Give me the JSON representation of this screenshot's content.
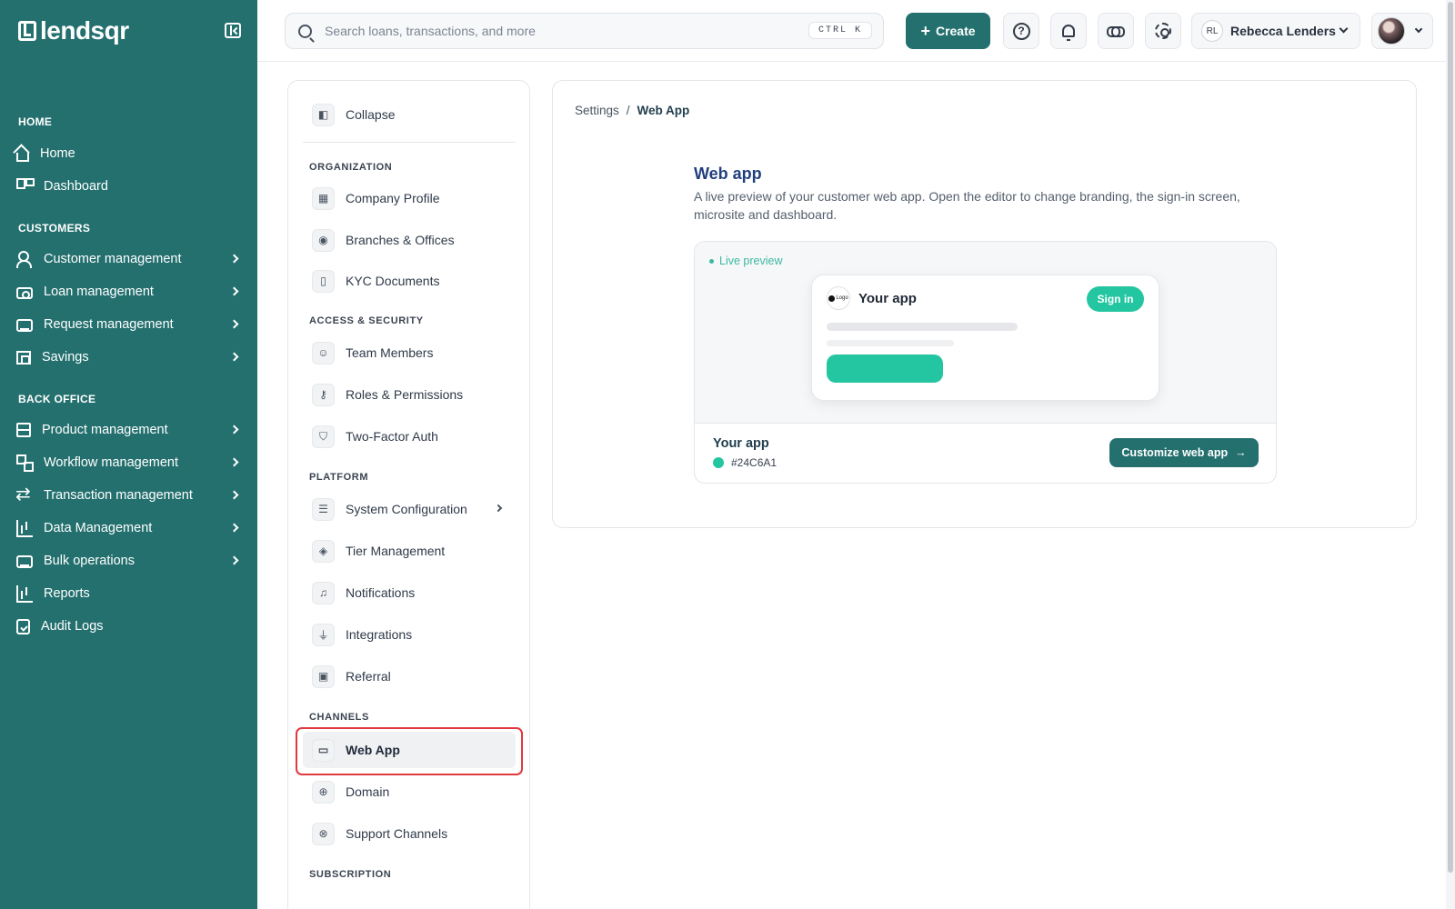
{
  "brand": {
    "name": "lendsqr"
  },
  "sidebar": {
    "sections": {
      "home": "HOME",
      "customers": "CUSTOMERS",
      "back_office": "BACK OFFICE"
    },
    "items": [
      {
        "label": "Home",
        "icon": "home-icon"
      },
      {
        "label": "Dashboard",
        "icon": "dashboard-icon"
      },
      {
        "label": "Customer management",
        "icon": "users-icon"
      },
      {
        "label": "Loan management",
        "icon": "loan-icon"
      },
      {
        "label": "Request management",
        "icon": "inbox-icon"
      },
      {
        "label": "Savings",
        "icon": "bank-icon"
      },
      {
        "label": "Product management",
        "icon": "box-icon"
      },
      {
        "label": "Workflow management",
        "icon": "workflow-icon"
      },
      {
        "label": "Transaction management",
        "icon": "swap-icon"
      },
      {
        "label": "Data Management",
        "icon": "bar-chart-icon"
      },
      {
        "label": "Bulk operations",
        "icon": "inbox-icon"
      },
      {
        "label": "Reports",
        "icon": "bar-chart-icon"
      },
      {
        "label": "Audit Logs",
        "icon": "clipboard-icon"
      }
    ]
  },
  "topbar": {
    "search_placeholder": "Search loans, transactions, and more",
    "shortcut": "CTRL K",
    "create_label": "Create",
    "user_initials": "RL",
    "user_name": "Rebecca Lenders"
  },
  "settings_nav": {
    "collapse": "Collapse",
    "sections": {
      "organization": "ORGANIZATION",
      "access": "ACCESS & SECURITY",
      "platform": "PLATFORM",
      "channels": "CHANNELS",
      "subscription": "SUBSCRIPTION"
    },
    "items": {
      "company_profile": "Company Profile",
      "branches": "Branches & Offices",
      "kyc": "KYC Documents",
      "team": "Team Members",
      "roles": "Roles & Permissions",
      "two_factor": "Two-Factor Auth",
      "system_config": "System Configuration",
      "tier": "Tier Management",
      "notifications": "Notifications",
      "integrations": "Integrations",
      "referral": "Referral",
      "web_app": "Web App",
      "domain": "Domain",
      "support": "Support Channels"
    }
  },
  "main": {
    "breadcrumb": {
      "parent": "Settings",
      "separator": "/",
      "current": "Web App"
    },
    "title": "Web app",
    "description": "A live preview of your customer web app. Open the editor to change branding, the sign-in screen, microsite and dashboard.",
    "preview": {
      "badge": "Live preview",
      "mock_logo_text": "Logo",
      "mock_app_title": "Your app",
      "mock_signin": "Sign in",
      "app_name": "Your app",
      "brand_color": "#24C6A1",
      "customize_label": "Customize web app",
      "customize_arrow": "→"
    }
  },
  "colors": {
    "sidebar_bg": "#24706F",
    "accent": "#24C6A1",
    "highlight": "#E0393E"
  }
}
